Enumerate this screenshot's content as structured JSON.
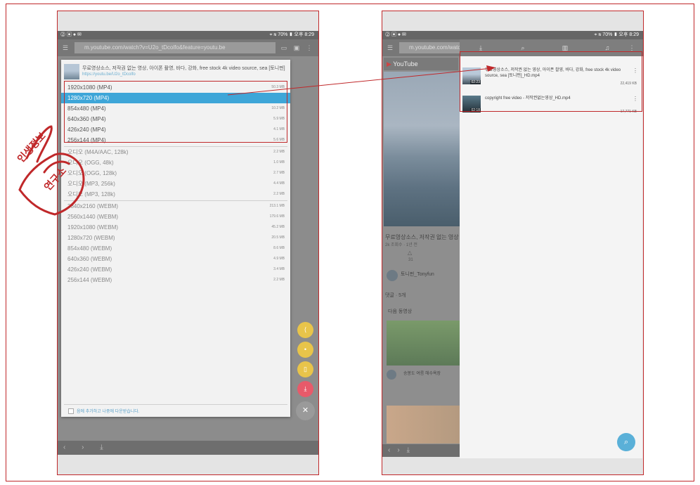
{
  "left": {
    "status_left": "⓶ ▣ ● ✉",
    "status_right": "⌖ ≋ 70% ▮ 오후 8:29",
    "url": "m.youtube.com/watch?v=U2o_tDcolfo&feature=youtu.be",
    "dialog": {
      "title": "무료영상소스, 저작권 없는 영상, 아이폰 촬영, 바다, 강화, free stock 4k video source, sea [토니펀]",
      "link": "https://youtu.be/U2o_tDcolfo",
      "formats": [
        {
          "label": "1920x1080 (MP4)",
          "size": "50.3 MB"
        },
        {
          "label": "1280x720 (MP4)",
          "size": ""
        },
        {
          "label": "854x480 (MP4)",
          "size": "10.2 MB"
        },
        {
          "label": "640x360 (MP4)",
          "size": "5.9 MB"
        },
        {
          "label": "426x240 (MP4)",
          "size": "4.1 MB"
        },
        {
          "label": "256x144 (MP4)",
          "size": "5.6 MB"
        }
      ],
      "audio": [
        {
          "label": "오디오 (M4A/AAC, 128k)",
          "size": "2.2 MB"
        },
        {
          "label": "오디오 (OGG, 48k)",
          "size": "1.0 MB"
        },
        {
          "label": "오디오 (OGG, 128k)",
          "size": "2.7 MB"
        },
        {
          "label": "오디오 (MP3, 256k)",
          "size": "4.4 MB"
        },
        {
          "label": "오디오 (MP3, 128k)",
          "size": "2.2 MB"
        }
      ],
      "webm": [
        {
          "label": "3840x2160 (WEBM)",
          "size": "213.1 MB"
        },
        {
          "label": "2560x1440 (WEBM)",
          "size": "179.6 MB"
        },
        {
          "label": "1920x1080 (WEBM)",
          "size": "45.2 MB"
        },
        {
          "label": "1280x720 (WEBM)",
          "size": "20.5 MB"
        },
        {
          "label": "854x480 (WEBM)",
          "size": "8.6 MB"
        },
        {
          "label": "640x360 (WEBM)",
          "size": "4.9 MB"
        },
        {
          "label": "426x240 (WEBM)",
          "size": "3.4 MB"
        },
        {
          "label": "256x144 (WEBM)",
          "size": "2.2 MB"
        }
      ],
      "checkbox_label": "음에 추가하고 나중에 다운받습니다."
    },
    "nav": "‹ › ⤓"
  },
  "right": {
    "status_left": "⓶ ▣ ● ✉",
    "status_right": "⌖ ≋ 70% ▮ 오후 8:29",
    "url": "m.youtube.com/watch",
    "youtube_label": "YouTube",
    "side_title": "무료영상소스, 저작권 없는 영상",
    "side_meta": "2k 조회수 · 1년 전",
    "like_count": "31",
    "channel": "토니펀_Tonyfun",
    "comments_label": "댓글 · 5개",
    "next_label": "다음 동영상",
    "card_title": "송봉도 여름 해수욕장",
    "downloads": [
      {
        "name": "무료영상소스, 저작권 없는 영상, 아이폰 촬영, 바다, 강화, free stock 4k video source, sea [토니펀]_HD.mp4",
        "duration": "02:23",
        "size": "22,419 KB"
      },
      {
        "name": "copyright free video - 저작권없는영상_HD.mp4",
        "duration": "02:18",
        "size": "17,771 KB"
      }
    ]
  },
  "annotation": {
    "line1": "인생정보",
    "line2": "연구소"
  }
}
